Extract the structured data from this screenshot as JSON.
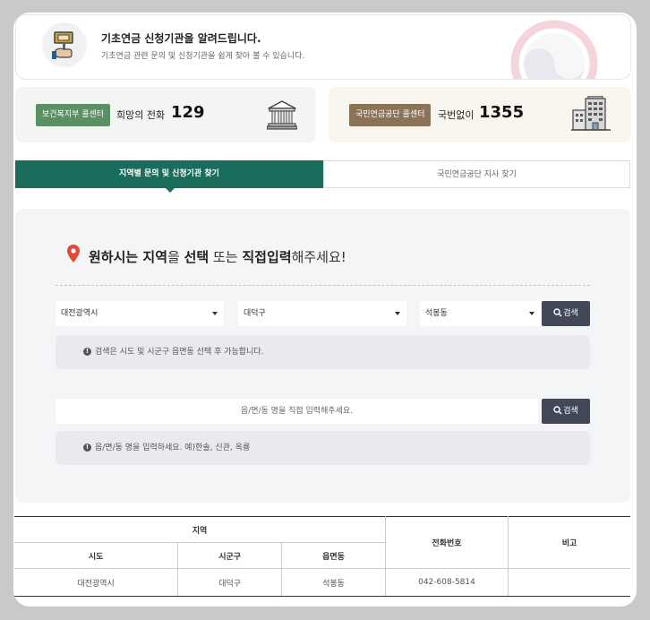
{
  "banner": {
    "title": "기초연금 신청기관을 알려드립니다.",
    "subtitle": "기초연금 관련 문의 및 신청기관을 쉽게 찾아 볼 수 있습니다."
  },
  "call_centers": [
    {
      "badge": "보건복지부 콜센터",
      "label": "희망의 전화",
      "number": "129",
      "color": "#5b8f64"
    },
    {
      "badge": "국민연금공단 콜센터",
      "label": "국번없이",
      "number": "1355",
      "color": "#8b7358"
    }
  ],
  "tabs": [
    {
      "label": "지역별 문의 및 신청기관 찾기",
      "active": true
    },
    {
      "label": "국민연금공단 지사 찾기",
      "active": false
    }
  ],
  "search": {
    "headline_parts": [
      "원하시는 지역",
      "을 ",
      "선택",
      " 또는 ",
      "직접입력",
      "해주세요!"
    ],
    "select_sido": "대전광역시",
    "select_sigungu": "대덕구",
    "select_dong": "석봉동",
    "search_label": "검색",
    "note_select": "검색은 시도 및 시군구 읍면동 선택 후 가능합니다.",
    "direct_placeholder": "읍/면/동 명을 직접 입력해주세요.",
    "note_direct": "읍/면/동 명을 입력하세요. 예)한솔, 신관, 옥룡"
  },
  "table": {
    "group_header": "지역",
    "headers": {
      "sido": "시도",
      "sigungu": "시군구",
      "dong": "읍면동",
      "phone": "전화번호",
      "remark": "비고"
    },
    "rows": [
      {
        "sido": "대전광역시",
        "sigungu": "대덕구",
        "dong": "석봉동",
        "phone": "042-608-5814",
        "remark": ""
      }
    ]
  },
  "colors": {
    "accent": "#1a6d5c",
    "button": "#434858",
    "pin": "#e04a3a"
  },
  "icons": [
    "signpost-icon",
    "government-building-icon",
    "office-building-icon",
    "map-pin-icon",
    "search-icon",
    "info-icon",
    "caret-down-icon"
  ]
}
